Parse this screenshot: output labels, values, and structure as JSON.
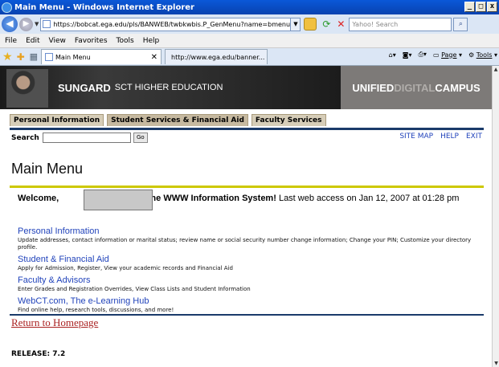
{
  "window": {
    "title": "Main Menu - Windows Internet Explorer",
    "controls": [
      "_",
      "□",
      "x"
    ]
  },
  "addressbar": {
    "url": "https://bobcat.ega.edu/pls/BANWEB/twbkwbis.P_GenMenu?name=bmenu.P_MainMnu&m",
    "search_placeholder": "Yahoo! Search"
  },
  "menubar": {
    "items": [
      "File",
      "Edit",
      "View",
      "Favorites",
      "Tools",
      "Help"
    ]
  },
  "browser_tabs": [
    {
      "label": "Main Menu"
    },
    {
      "label": "http://www.ega.edu/banner..."
    }
  ],
  "command_bar": {
    "page_label": "Page",
    "tools_label": "Tools"
  },
  "banner": {
    "brand": "SUNGARD",
    "brand_sub": "SCT HIGHER EDUCATION",
    "udc_part1": "UNIFIED",
    "udc_part2": "DIGITAL",
    "udc_part3": "CAMPUS"
  },
  "page_tabs": [
    {
      "label": "Personal Information"
    },
    {
      "label": "Student Services & Financial Aid"
    },
    {
      "label": "Faculty Services"
    }
  ],
  "search": {
    "label": "Search",
    "go_label": "Go"
  },
  "top_links": [
    "SITE MAP",
    "HELP",
    "EXIT"
  ],
  "page_title": "Main Menu",
  "welcome": {
    "prefix": "Welcome,",
    "middle": ", to the WWW Information System!",
    "suffix": " Last web access on Jan 12, 2007 at 01:28 pm"
  },
  "menu_items": [
    {
      "link": "Personal Information",
      "desc": "Update addresses, contact information or marital status; review name or social security number change information; Change your PIN; Customize your directory profile."
    },
    {
      "link": "Student & Financial Aid",
      "desc": "Apply for Admission, Register, View your academic records and Financial Aid"
    },
    {
      "link": "Faculty & Advisors",
      "desc": "Enter Grades and Registration Overrides, View Class Lists and Student Information"
    },
    {
      "link": "WebCT.com, The e-Learning Hub",
      "desc": "Find online help, research tools, discussions, and more!"
    }
  ],
  "return_link": "Return to Homepage",
  "release": "RELEASE: 7.2"
}
